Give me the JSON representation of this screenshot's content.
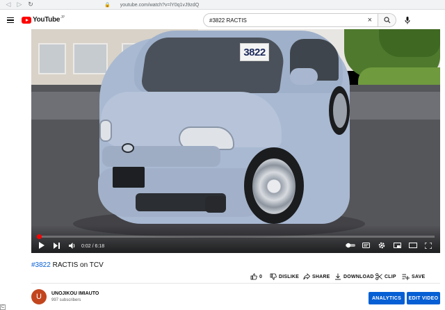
{
  "browser": {
    "url": "youtube.com/watch?v=lY0q1vJ9zdQ"
  },
  "header": {
    "logo_text": "YouTube",
    "logo_sup": "JP",
    "search_value": "#3822 RACTIS"
  },
  "player": {
    "price_card": "3822",
    "time": "0:02 / 6:18",
    "progress_fraction": 0.005
  },
  "video": {
    "title_hashtag": "#3822",
    "title_rest": " RACTIS on TCV"
  },
  "actions": {
    "like_count": "0",
    "dislike": "DISLIKE",
    "share": "SHARE",
    "download": "DOWNLOAD",
    "clip": "CLIP",
    "save": "SAVE"
  },
  "channel": {
    "avatar_letter": "U",
    "name": "UNOJIKOU IMIAUTO",
    "subscribers": "997 subscribers"
  },
  "buttons": {
    "analytics": "ANALYTICS",
    "edit_video": "EDIT VIDEO"
  },
  "colors": {
    "brand_red": "#ff0000",
    "link_blue": "#065fd4",
    "button_blue": "#065fd4"
  },
  "corner_marker": "C"
}
